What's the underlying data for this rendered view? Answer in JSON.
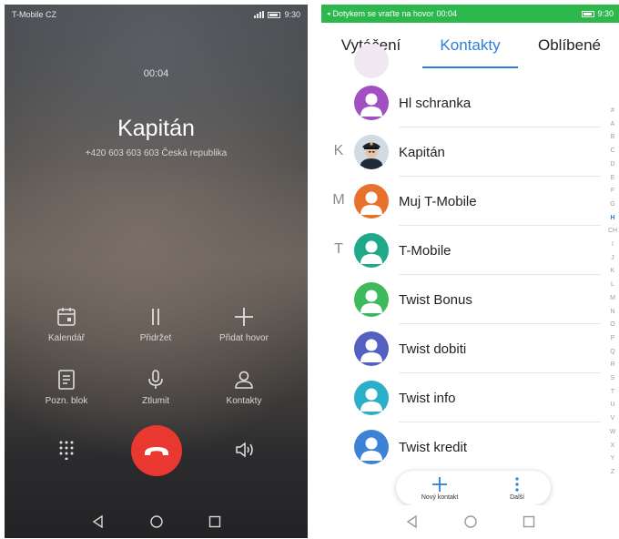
{
  "call_screen": {
    "status": {
      "carrier": "T-Mobile CZ",
      "time": "9:30"
    },
    "timer": "00:04",
    "contact_name": "Kapitán",
    "number_line": "+420 603 603 603   Česká republika",
    "controls": [
      {
        "label": "Kalendář",
        "icon": "calendar-icon"
      },
      {
        "label": "Přidržet",
        "icon": "pause-icon"
      },
      {
        "label": "Přidat hovor",
        "icon": "plus-icon"
      },
      {
        "label": "Pozn. blok",
        "icon": "notepad-icon"
      },
      {
        "label": "Ztlumit",
        "icon": "microphone-icon"
      },
      {
        "label": "Kontakty",
        "icon": "person-icon"
      }
    ],
    "end_call_color": "#e8382f"
  },
  "contacts_screen": {
    "status": {
      "return_text": "Dotykem se vraťte na hovor",
      "call_time": "00:04",
      "time": "9:30",
      "color": "#2db84d"
    },
    "tabs": [
      "Vytáčení",
      "Kontakty",
      "Oblíbené"
    ],
    "active_tab": "Kontakty",
    "contacts": [
      {
        "letter": "",
        "name": "Hl schranka",
        "color": "#a050c0"
      },
      {
        "letter": "K",
        "name": "Kapitán",
        "color": "photo"
      },
      {
        "letter": "M",
        "name": "Muj T-Mobile",
        "color": "#e8712c"
      },
      {
        "letter": "T",
        "name": "T-Mobile",
        "color": "#1fa88a"
      },
      {
        "letter": "",
        "name": "Twist Bonus",
        "color": "#3dbb5c"
      },
      {
        "letter": "",
        "name": "Twist dobiti",
        "color": "#5460c0"
      },
      {
        "letter": "",
        "name": "Twist info",
        "color": "#2ab0c8"
      },
      {
        "letter": "",
        "name": "Twist kredit",
        "color": "#3d82d6"
      }
    ],
    "index": [
      "#",
      "A",
      "B",
      "C",
      "D",
      "E",
      "F",
      "G",
      "H",
      "CH",
      "I",
      "J",
      "K",
      "L",
      "M",
      "N",
      "O",
      "P",
      "Q",
      "R",
      "S",
      "T",
      "U",
      "V",
      "W",
      "X",
      "Y",
      "Z"
    ],
    "index_active": "H",
    "fab": {
      "new_contact": "Nový kontakt",
      "more": "Další"
    },
    "accent": "#2b7fd9"
  }
}
